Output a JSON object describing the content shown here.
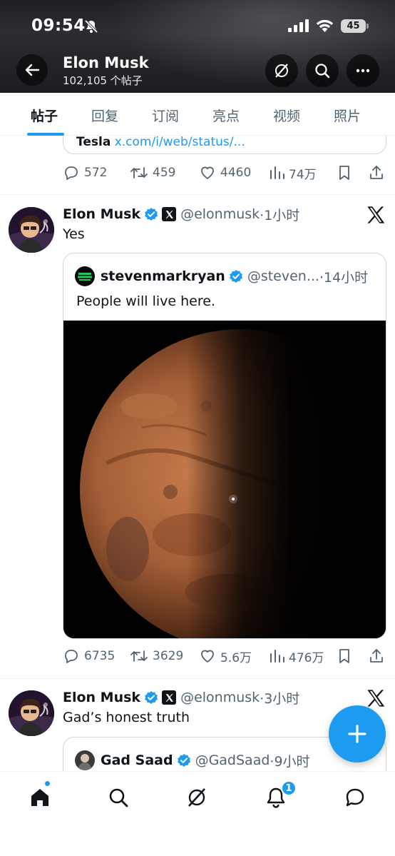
{
  "status_bar": {
    "time": "09:54",
    "battery": "45"
  },
  "header": {
    "name": "Elon Musk",
    "post_count": "102,105 个帖子"
  },
  "tabs": [
    {
      "label": "帖子",
      "active": true
    },
    {
      "label": "回复"
    },
    {
      "label": "订阅"
    },
    {
      "label": "亮点"
    },
    {
      "label": "视频"
    },
    {
      "label": "照片"
    }
  ],
  "prev_tweet": {
    "card_text_prefix": "Tesla",
    "card_text_link": "x.com/i/web/status/...",
    "replies": "572",
    "reposts": "459",
    "likes": "4460",
    "views": "74万"
  },
  "tweet1": {
    "name": "Elon Musk",
    "handle": "@elonmusk",
    "time": "·1小时",
    "text": "Yes",
    "quote": {
      "name": "stevenmarkryan",
      "handle": "@steven...",
      "time": "·14小时",
      "text": "People will live here."
    },
    "replies": "6735",
    "reposts": "3629",
    "likes": "5.6万",
    "views": "476万"
  },
  "tweet2": {
    "name": "Elon Musk",
    "handle": "@elonmusk",
    "time": "·3小时",
    "text": "Gad’s honest truth",
    "quote": {
      "name": "Gad Saad",
      "handle": "@GadSaad",
      "time": "·9小时"
    }
  },
  "notifications_badge": "1",
  "colors": {
    "accent": "#1d9bf0",
    "text": "#0f1419",
    "secondary": "#536471"
  }
}
